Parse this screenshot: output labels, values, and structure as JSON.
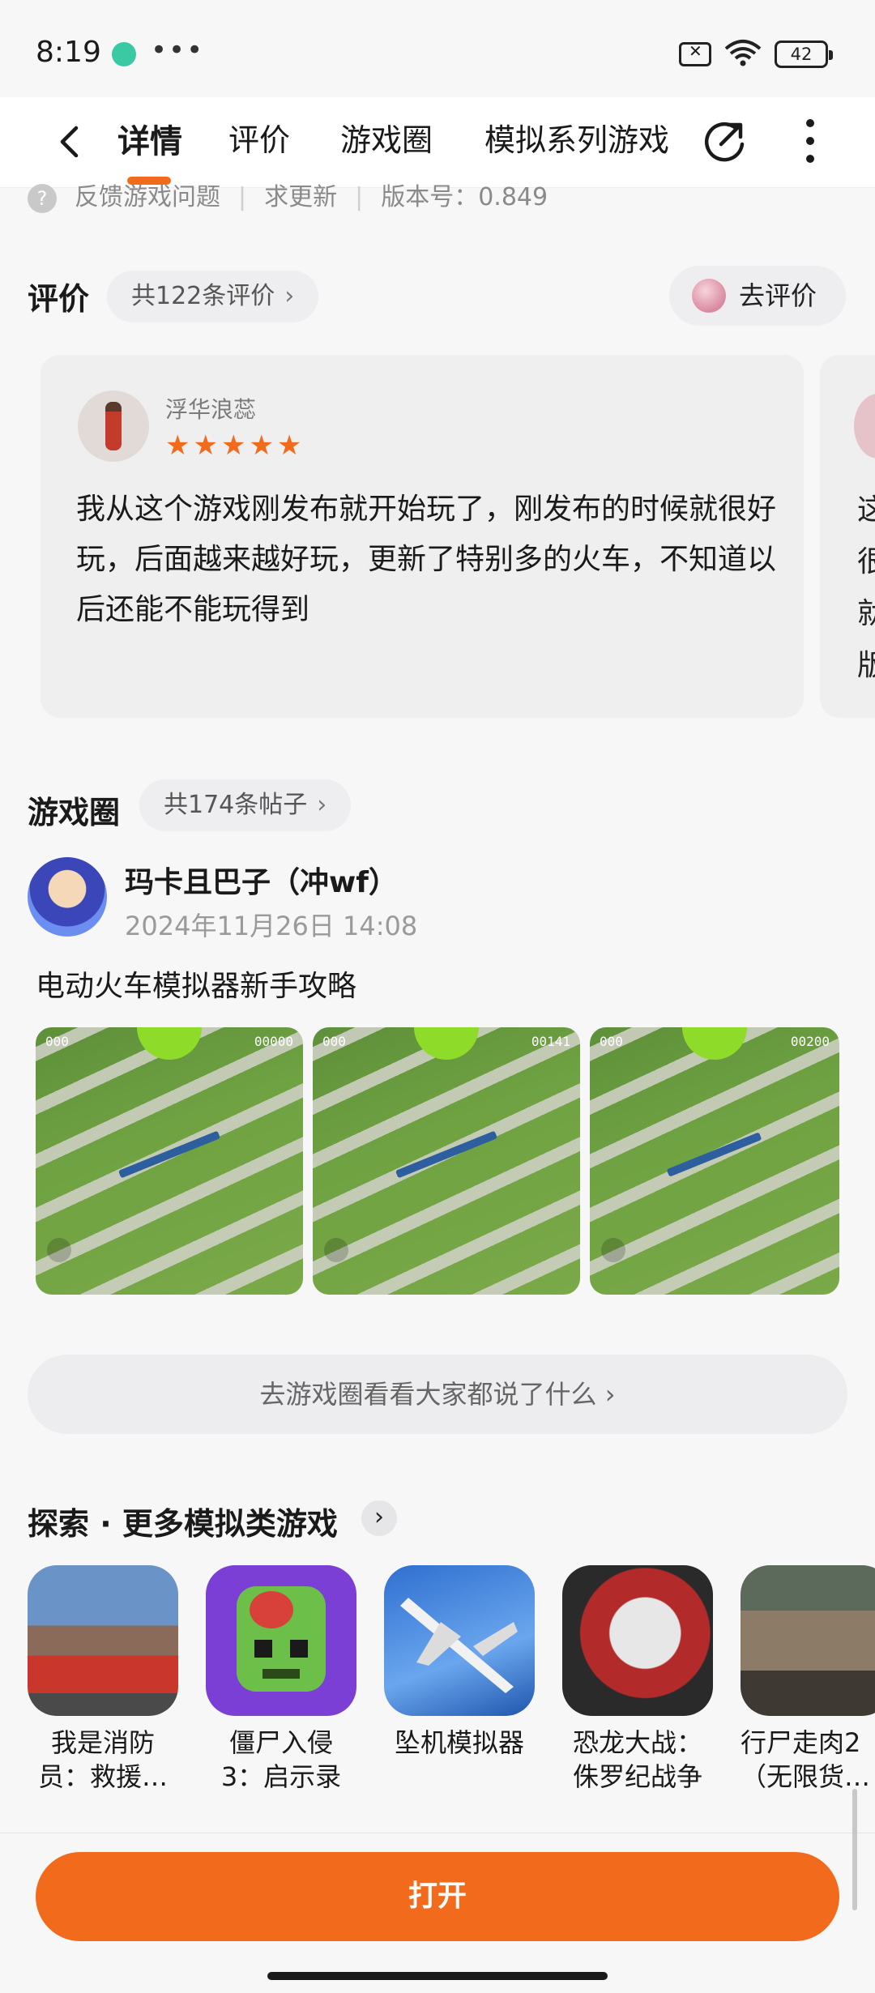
{
  "status": {
    "time": "8:19",
    "more": "•••",
    "battery": "42"
  },
  "nav": {
    "tabs": [
      "详情",
      "评价",
      "游戏圈",
      "模拟系列游戏"
    ],
    "active_tab": 0
  },
  "partial_row": {
    "feedback": "反馈游戏问题",
    "request_update": "求更新",
    "version": "版本号：0.849"
  },
  "reviews": {
    "title": "评价",
    "count_label": "共122条评价",
    "rate_button": "去评价",
    "items": [
      {
        "user": "浮华浪蕊",
        "stars": 5,
        "stars_text": "★★★★★",
        "text": " 我从这个游戏刚发布就开始玩了，刚发布的时候就很好玩，后面越来越好玩，更新了特别多的火车，不知道以后还能不能玩得到"
      }
    ],
    "next_preview": "这\n很\n就\n版"
  },
  "community": {
    "title": "游戏圈",
    "count_label": "共174条帖子",
    "post": {
      "user": "玛卡且巴子（冲wf）",
      "time": "2024年11月26日 14:08",
      "title": "电动火车模拟器新手攻略",
      "images": [
        {
          "hud_left": "000",
          "hud_right": "00000"
        },
        {
          "hud_left": "000",
          "hud_right": "00141"
        },
        {
          "hud_left": "000",
          "hud_right": "00200"
        }
      ]
    },
    "more_label": "去游戏圈看看大家都说了什么"
  },
  "explore": {
    "title": "探索 · 更多模拟类游戏",
    "games": [
      {
        "name": "我是消防\n员：救援…",
        "icon": "fire-truck-icon"
      },
      {
        "name": "僵尸入侵\n3：启示录",
        "icon": "zombie-head-icon"
      },
      {
        "name": "坠机模拟器",
        "icon": "airplane-icon"
      },
      {
        "name": "恐龙大战：\n侏罗纪战争",
        "icon": "dinosaur-icon"
      },
      {
        "name": "行尸走肉2\n（无限货…",
        "icon": "walking-zombie-icon"
      }
    ]
  },
  "actions": {
    "open": "打开"
  },
  "colors": {
    "accent": "#f26b1d",
    "background": "#f7f7f8"
  }
}
